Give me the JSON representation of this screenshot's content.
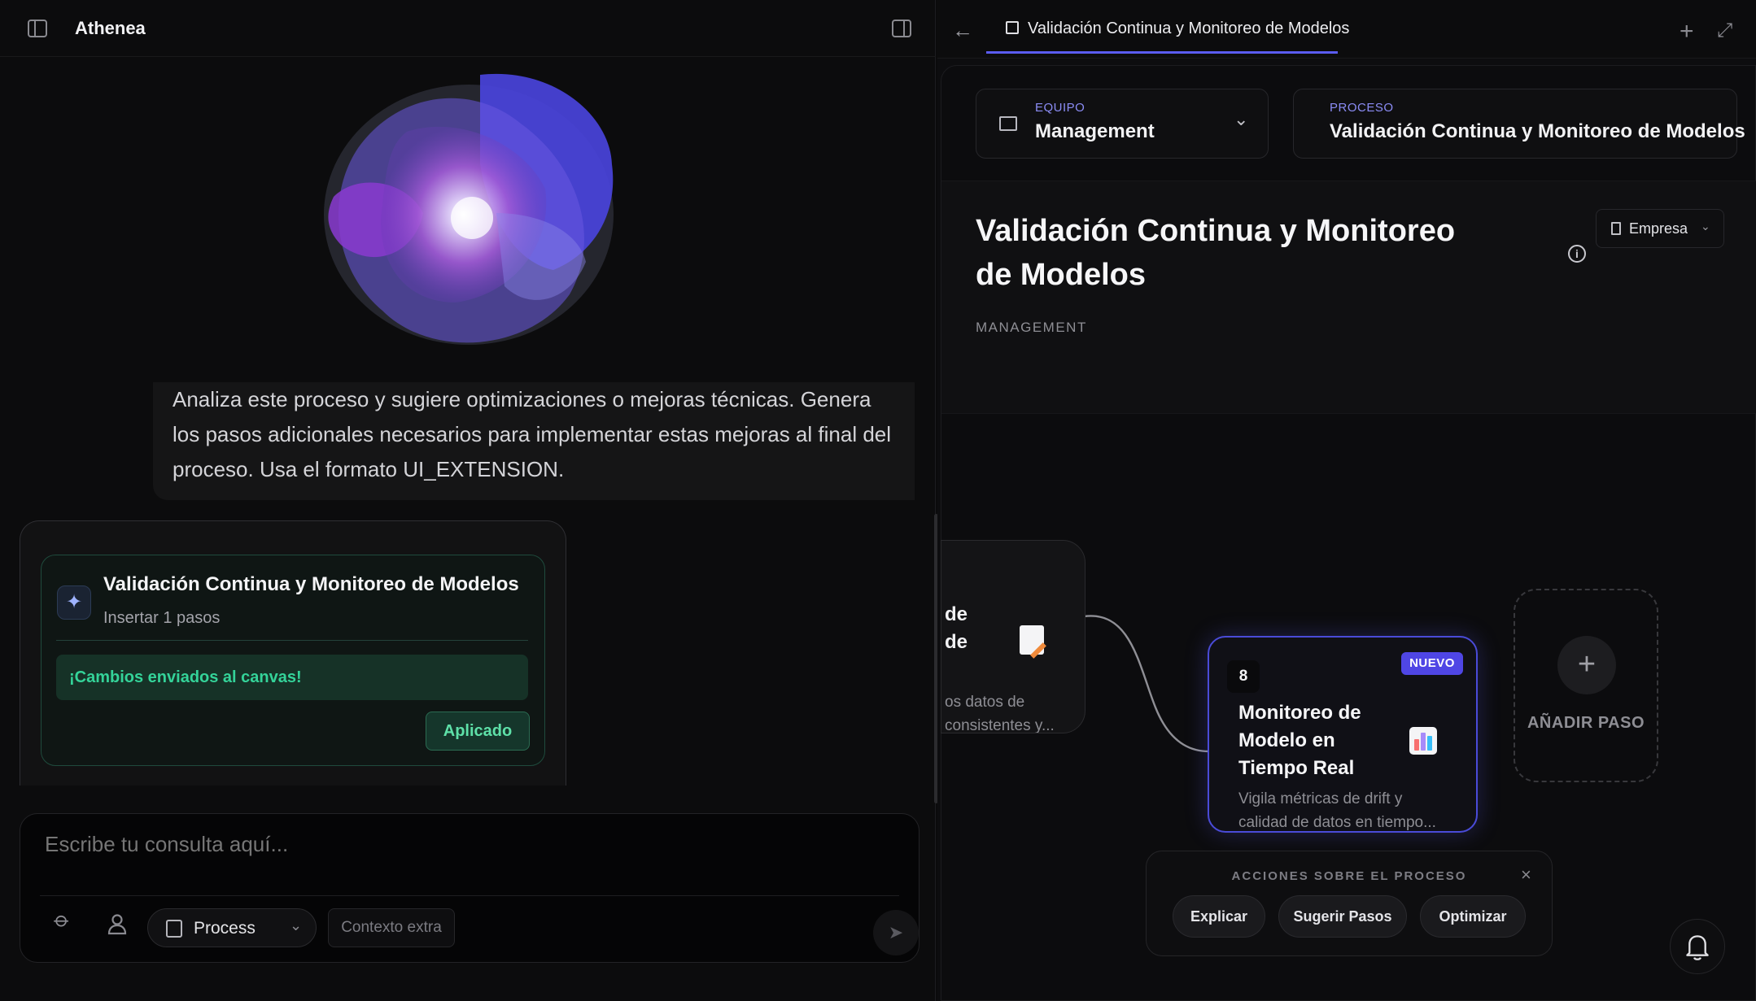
{
  "app": {
    "title": "Athenea"
  },
  "chat": {
    "user_message": "Analiza este proceso y sugiere optimizaciones o mejoras técnicas. Genera los pasos adicionales necesarios para implementar estas mejoras al final del proceso. Usa el formato UI_EXTENSION.",
    "extension_card": {
      "title": "Validación Continua y Monitoreo de Modelos",
      "subtitle": "Insertar 1 pasos",
      "status": "¡Cambios enviados al canvas!",
      "applied_label": "Aplicado",
      "icon": "sparkles-icon"
    },
    "composer": {
      "placeholder": "Escribe tu consulta aquí...",
      "process_label": "Process",
      "extra_context_label": "Contexto extra"
    }
  },
  "canvas_tab": {
    "label": "Validación Continua y Monitoreo de Modelos"
  },
  "selectors": {
    "team": {
      "label": "EQUIPO",
      "value": "Management"
    },
    "process": {
      "label": "PROCESO",
      "value": "Validación Continua y Monitoreo de Modelos"
    }
  },
  "process": {
    "title": "Validación Continua y Monitoreo de Modelos",
    "team": "MANAGEMENT",
    "scope_label": "Empresa"
  },
  "nodes": {
    "previous": {
      "title_line1": "de",
      "title_line2": "de",
      "desc_line1": "os datos de",
      "desc_line2": "consistentes y..."
    },
    "new": {
      "number": "8",
      "badge": "NUEVO",
      "title": "Monitoreo de Modelo en Tiempo Real",
      "desc_line1": "Vigila métricas de drift y",
      "desc_line2": "calidad de datos en tiempo..."
    },
    "add_step_label": "AÑADIR PASO"
  },
  "actions": {
    "heading": "ACCIONES SOBRE EL PROCESO",
    "buttons": [
      "Explicar",
      "Sugerir Pasos",
      "Optimizar"
    ]
  },
  "colors": {
    "accent": "#4f46e5",
    "success": "#34d399",
    "label_purple": "#8b8cf5"
  }
}
